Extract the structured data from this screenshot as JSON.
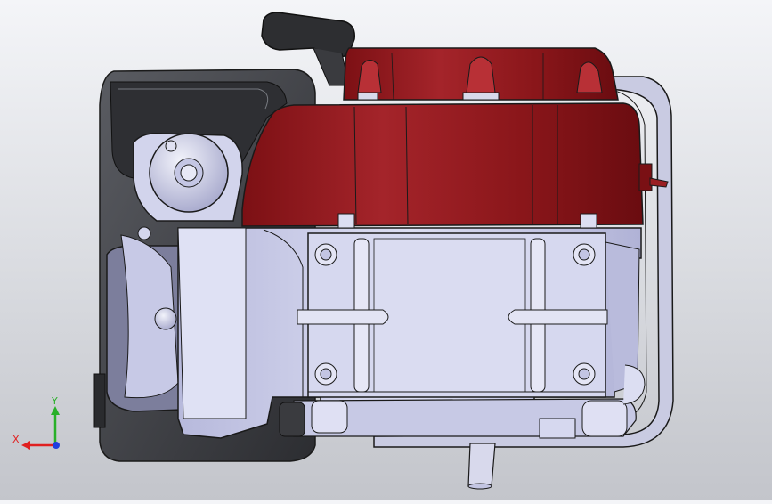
{
  "viewport": {
    "background_top": "#f4f5f8",
    "background_bottom": "#c3c5cb"
  },
  "model": {
    "colors": {
      "shroud": "#8e1518",
      "shroud_dark": "#6a0c10",
      "shroud_light": "#b02a2e",
      "block": "#cfd1ea",
      "block_shade": "#a9abd0",
      "block_light": "#e4e6f6",
      "housing_dark": "#3a3b3f",
      "housing_mid": "#55575c",
      "outline": "#1a1a1a"
    }
  },
  "triad": {
    "x_label": "X",
    "y_label": "Y",
    "x_color": "#e02020",
    "y_color": "#28b028",
    "z_color": "#2040e0"
  }
}
